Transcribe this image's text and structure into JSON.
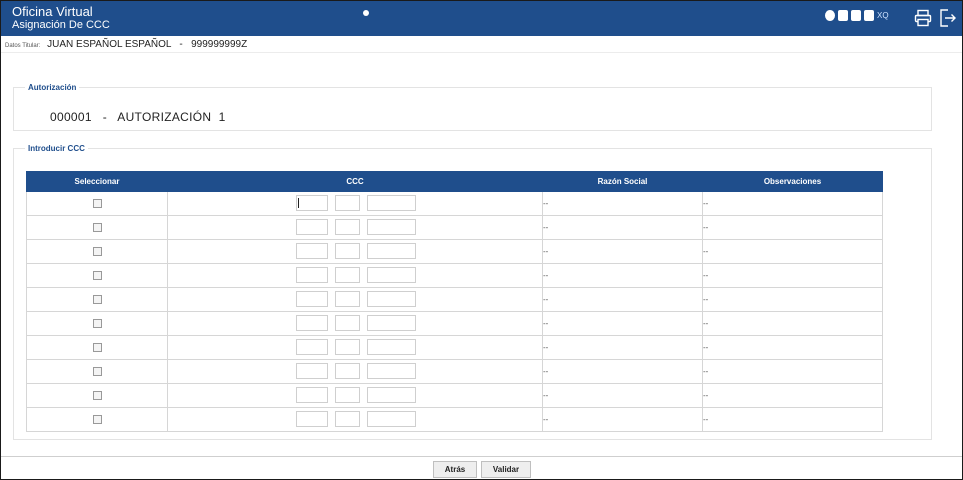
{
  "header": {
    "title": "Oficina Virtual",
    "subtitle": "Asignación De CCC",
    "icons": [
      "globe-icon",
      "document-icon",
      "document-icon",
      "document-icon",
      "xq-icon"
    ],
    "icon_xq_text": "XQ",
    "accent_color": "#1f4e8c"
  },
  "holder": {
    "label": "Datos Titular:",
    "value": "JUAN ESPAÑOL ESPAÑOL   -   999999999Z"
  },
  "authorization": {
    "legend": "Autorización",
    "value": "000001   -   AUTORIZACIÓN  1"
  },
  "ccc_section": {
    "legend": "Introducir CCC",
    "columns": [
      "Seleccionar",
      "CCC",
      "Razón Social",
      "Observaciones"
    ],
    "rows": [
      {
        "razon": "--",
        "obs": "--"
      },
      {
        "razon": "--",
        "obs": "--"
      },
      {
        "razon": "--",
        "obs": "--"
      },
      {
        "razon": "--",
        "obs": "--"
      },
      {
        "razon": "--",
        "obs": "--"
      },
      {
        "razon": "--",
        "obs": "--"
      },
      {
        "razon": "--",
        "obs": "--"
      },
      {
        "razon": "--",
        "obs": "--"
      },
      {
        "razon": "--",
        "obs": "--"
      },
      {
        "razon": "--",
        "obs": "--"
      }
    ]
  },
  "footer": {
    "back_label": "Atrás",
    "validate_label": "Validar"
  }
}
